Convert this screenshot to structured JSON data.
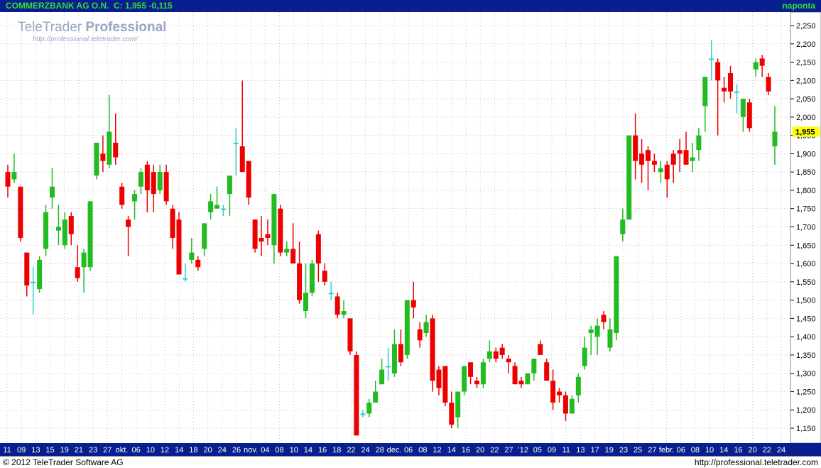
{
  "header": {
    "name": "COMMERZBANK AG O.N.",
    "quote": "C: 1,955 -0,115",
    "period": "naponta"
  },
  "watermark": {
    "brand_light": "TeleTrader",
    "brand_bold": "Professional",
    "url": "http://professional.teletrader.com/"
  },
  "footer": {
    "copyright": "© 2012  TeleTrader Software AG",
    "url": "http://professional.teletrader.com"
  },
  "colors": {
    "up": "#22bb22",
    "down": "#ee0000",
    "doji": "#33cccc",
    "axis_bg": "#0a1f8f",
    "price_tag": "#ffff00"
  },
  "chart_data": {
    "type": "candlestick",
    "ylim": [
      1.12,
      2.28
    ],
    "yticks": [
      "2,250",
      "2,200",
      "2,150",
      "2,100",
      "2,050",
      "2,000",
      "1,950",
      "1,900",
      "1,850",
      "1,800",
      "1,750",
      "1,700",
      "1,650",
      "1,600",
      "1,550",
      "1,500",
      "1,450",
      "1,400",
      "1,350",
      "1,300",
      "1,250",
      "1,200",
      "1,150"
    ],
    "last_price_label": "1,955",
    "grid": true,
    "xticks": [
      "11",
      "09",
      "13",
      "15",
      "19",
      "21",
      "23",
      "27",
      "okt.",
      "06",
      "10",
      "12",
      "14",
      "18",
      "20",
      "24",
      "26",
      "nov.",
      "04",
      "08",
      "10",
      "14",
      "16",
      "18",
      "22",
      "24",
      "28",
      "dec.",
      "06",
      "08",
      "12",
      "14",
      "16",
      "20",
      "22",
      "27",
      "'12",
      "05",
      "09",
      "11",
      "13",
      "17",
      "19",
      "23",
      "25",
      "27",
      "febr.",
      "06",
      "08",
      "10",
      "14",
      "16",
      "20",
      "22",
      "24"
    ],
    "candles": [
      [
        1.85,
        1.87,
        1.78,
        1.81
      ],
      [
        1.83,
        1.9,
        1.82,
        1.85
      ],
      [
        1.81,
        1.81,
        1.66,
        1.67
      ],
      [
        1.63,
        1.63,
        1.51,
        1.54
      ],
      [
        1.55,
        1.59,
        1.46,
        1.55
      ],
      [
        1.53,
        1.62,
        1.52,
        1.61
      ],
      [
        1.64,
        1.76,
        1.62,
        1.74
      ],
      [
        1.78,
        1.86,
        1.75,
        1.81
      ],
      [
        1.69,
        1.76,
        1.65,
        1.7
      ],
      [
        1.65,
        1.74,
        1.64,
        1.72
      ],
      [
        1.73,
        1.74,
        1.65,
        1.68
      ],
      [
        1.59,
        1.65,
        1.55,
        1.56
      ],
      [
        1.59,
        1.64,
        1.52,
        1.63
      ],
      [
        1.59,
        1.76,
        1.58,
        1.77
      ],
      [
        1.84,
        1.93,
        1.83,
        1.93
      ],
      [
        1.9,
        1.95,
        1.85,
        1.88
      ],
      [
        1.87,
        2.06,
        1.86,
        1.96
      ],
      [
        1.93,
        2.01,
        1.87,
        1.89
      ],
      [
        1.81,
        1.82,
        1.75,
        1.76
      ],
      [
        1.72,
        1.73,
        1.62,
        1.7
      ],
      [
        1.77,
        1.8,
        1.72,
        1.79
      ],
      [
        1.81,
        1.86,
        1.79,
        1.85
      ],
      [
        1.87,
        1.88,
        1.74,
        1.8
      ],
      [
        1.85,
        1.87,
        1.74,
        1.79
      ],
      [
        1.8,
        1.87,
        1.79,
        1.85
      ],
      [
        1.85,
        1.87,
        1.76,
        1.77
      ],
      [
        1.75,
        1.76,
        1.64,
        1.67
      ],
      [
        1.72,
        1.74,
        1.58,
        1.57
      ],
      [
        1.56,
        1.6,
        1.55,
        1.56
      ],
      [
        1.61,
        1.67,
        1.6,
        1.63
      ],
      [
        1.61,
        1.62,
        1.58,
        1.59
      ],
      [
        1.64,
        1.71,
        1.62,
        1.71
      ],
      [
        1.74,
        1.79,
        1.72,
        1.77
      ],
      [
        1.75,
        1.81,
        1.75,
        1.76
      ],
      [
        1.75,
        1.76,
        1.73,
        1.75
      ],
      [
        1.79,
        1.83,
        1.73,
        1.84
      ],
      [
        1.93,
        1.97,
        1.84,
        1.93
      ],
      [
        1.92,
        2.1,
        1.88,
        1.85
      ],
      [
        1.88,
        1.88,
        1.76,
        1.78
      ],
      [
        1.72,
        1.72,
        1.63,
        1.64
      ],
      [
        1.67,
        1.73,
        1.62,
        1.66
      ],
      [
        1.68,
        1.72,
        1.65,
        1.67
      ],
      [
        1.65,
        1.78,
        1.6,
        1.79
      ],
      [
        1.75,
        1.76,
        1.62,
        1.63
      ],
      [
        1.63,
        1.66,
        1.62,
        1.64
      ],
      [
        1.64,
        1.71,
        1.64,
        1.6
      ],
      [
        1.6,
        1.66,
        1.49,
        1.5
      ],
      [
        1.47,
        1.6,
        1.45,
        1.52
      ],
      [
        1.52,
        1.61,
        1.51,
        1.6
      ],
      [
        1.68,
        1.69,
        1.55,
        1.6
      ],
      [
        1.58,
        1.6,
        1.54,
        1.55
      ],
      [
        1.52,
        1.55,
        1.5,
        1.52
      ],
      [
        1.51,
        1.52,
        1.45,
        1.46
      ],
      [
        1.46,
        1.5,
        1.45,
        1.47
      ],
      [
        1.45,
        1.43,
        1.35,
        1.36
      ],
      [
        1.35,
        1.36,
        1.14,
        1.13
      ],
      [
        1.19,
        1.2,
        1.18,
        1.19
      ],
      [
        1.19,
        1.23,
        1.18,
        1.22
      ],
      [
        1.22,
        1.28,
        1.22,
        1.25
      ],
      [
        1.27,
        1.34,
        1.28,
        1.31
      ],
      [
        1.32,
        1.37,
        1.28,
        1.32
      ],
      [
        1.3,
        1.42,
        1.29,
        1.38
      ],
      [
        1.38,
        1.42,
        1.32,
        1.33
      ],
      [
        1.35,
        1.45,
        1.34,
        1.5
      ],
      [
        1.5,
        1.55,
        1.45,
        1.48
      ],
      [
        1.42,
        1.44,
        1.37,
        1.39
      ],
      [
        1.41,
        1.46,
        1.4,
        1.44
      ],
      [
        1.45,
        1.46,
        1.25,
        1.28
      ],
      [
        1.31,
        1.32,
        1.24,
        1.26
      ],
      [
        1.32,
        1.32,
        1.21,
        1.22
      ],
      [
        1.22,
        1.25,
        1.15,
        1.16
      ],
      [
        1.18,
        1.23,
        1.15,
        1.25
      ],
      [
        1.25,
        1.32,
        1.24,
        1.32
      ],
      [
        1.33,
        1.33,
        1.27,
        1.29
      ],
      [
        1.28,
        1.29,
        1.26,
        1.27
      ],
      [
        1.27,
        1.34,
        1.26,
        1.33
      ],
      [
        1.34,
        1.39,
        1.33,
        1.36
      ],
      [
        1.36,
        1.37,
        1.33,
        1.34
      ],
      [
        1.37,
        1.38,
        1.34,
        1.35
      ],
      [
        1.34,
        1.35,
        1.3,
        1.33
      ],
      [
        1.32,
        1.33,
        1.27,
        1.27
      ],
      [
        1.28,
        1.29,
        1.26,
        1.27
      ],
      [
        1.27,
        1.3,
        1.27,
        1.3
      ],
      [
        1.3,
        1.34,
        1.28,
        1.34
      ],
      [
        1.38,
        1.39,
        1.35,
        1.35
      ],
      [
        1.33,
        1.34,
        1.28,
        1.28
      ],
      [
        1.28,
        1.31,
        1.2,
        1.22
      ],
      [
        1.25,
        1.26,
        1.22,
        1.24
      ],
      [
        1.24,
        1.25,
        1.17,
        1.19
      ],
      [
        1.19,
        1.24,
        1.19,
        1.23
      ],
      [
        1.24,
        1.3,
        1.22,
        1.29
      ],
      [
        1.32,
        1.4,
        1.31,
        1.37
      ],
      [
        1.41,
        1.43,
        1.35,
        1.42
      ],
      [
        1.4,
        1.45,
        1.35,
        1.43
      ],
      [
        1.46,
        1.47,
        1.42,
        1.44
      ],
      [
        1.37,
        1.45,
        1.36,
        1.42
      ],
      [
        1.41,
        1.62,
        1.39,
        1.62
      ],
      [
        1.68,
        1.75,
        1.66,
        1.72
      ],
      [
        1.72,
        1.76,
        1.74,
        1.95
      ],
      [
        1.95,
        2.01,
        1.83,
        1.88
      ],
      [
        1.9,
        1.94,
        1.82,
        1.87
      ],
      [
        1.91,
        1.92,
        1.8,
        1.88
      ],
      [
        1.88,
        1.9,
        1.85,
        1.87
      ],
      [
        1.85,
        1.88,
        1.82,
        1.86
      ],
      [
        1.87,
        1.88,
        1.78,
        1.83
      ],
      [
        1.9,
        1.91,
        1.82,
        1.87
      ],
      [
        1.91,
        1.94,
        1.85,
        1.9
      ],
      [
        1.91,
        1.96,
        1.87,
        1.87
      ],
      [
        1.88,
        1.93,
        1.85,
        1.89
      ],
      [
        1.91,
        1.97,
        1.88,
        1.95
      ],
      [
        2.03,
        2.1,
        1.96,
        2.11
      ],
      [
        2.16,
        2.21,
        2.1,
        2.16
      ],
      [
        2.15,
        2.16,
        1.95,
        2.1
      ],
      [
        2.08,
        2.11,
        2.04,
        2.07
      ],
      [
        2.12,
        2.14,
        2.05,
        2.07
      ],
      [
        2.07,
        2.09,
        2.01,
        2.07
      ],
      [
        2.0,
        2.04,
        1.96,
        2.05
      ],
      [
        2.04,
        2.05,
        1.96,
        1.97
      ],
      [
        2.13,
        2.16,
        2.11,
        2.15
      ],
      [
        2.16,
        2.17,
        2.11,
        2.14
      ],
      [
        2.11,
        2.12,
        2.06,
        2.07
      ],
      [
        1.92,
        2.03,
        1.87,
        1.96
      ]
    ]
  }
}
